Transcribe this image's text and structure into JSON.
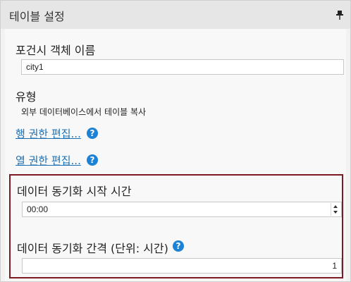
{
  "header": {
    "title": "테이블 설정",
    "pin_icon": "pin-icon"
  },
  "forecast": {
    "label": "포건시 객체 이름",
    "value": "city1"
  },
  "type": {
    "label": "유형",
    "value": "외부 데이터베이스에서 테이블 복사"
  },
  "links": {
    "row_permissions": "행 권한 편집...",
    "column_permissions": "열 권한 편집..."
  },
  "sync": {
    "start_label": "데이터 동기화 시작 시간",
    "start_value": "00:00",
    "interval_label": "데이터 동기화 간격 (단위: 시간)",
    "interval_value": "1"
  },
  "help_glyph": "?",
  "colors": {
    "link": "#1a6fb5",
    "help_icon": "#1b82d6",
    "group_border": "#7b1b24"
  }
}
